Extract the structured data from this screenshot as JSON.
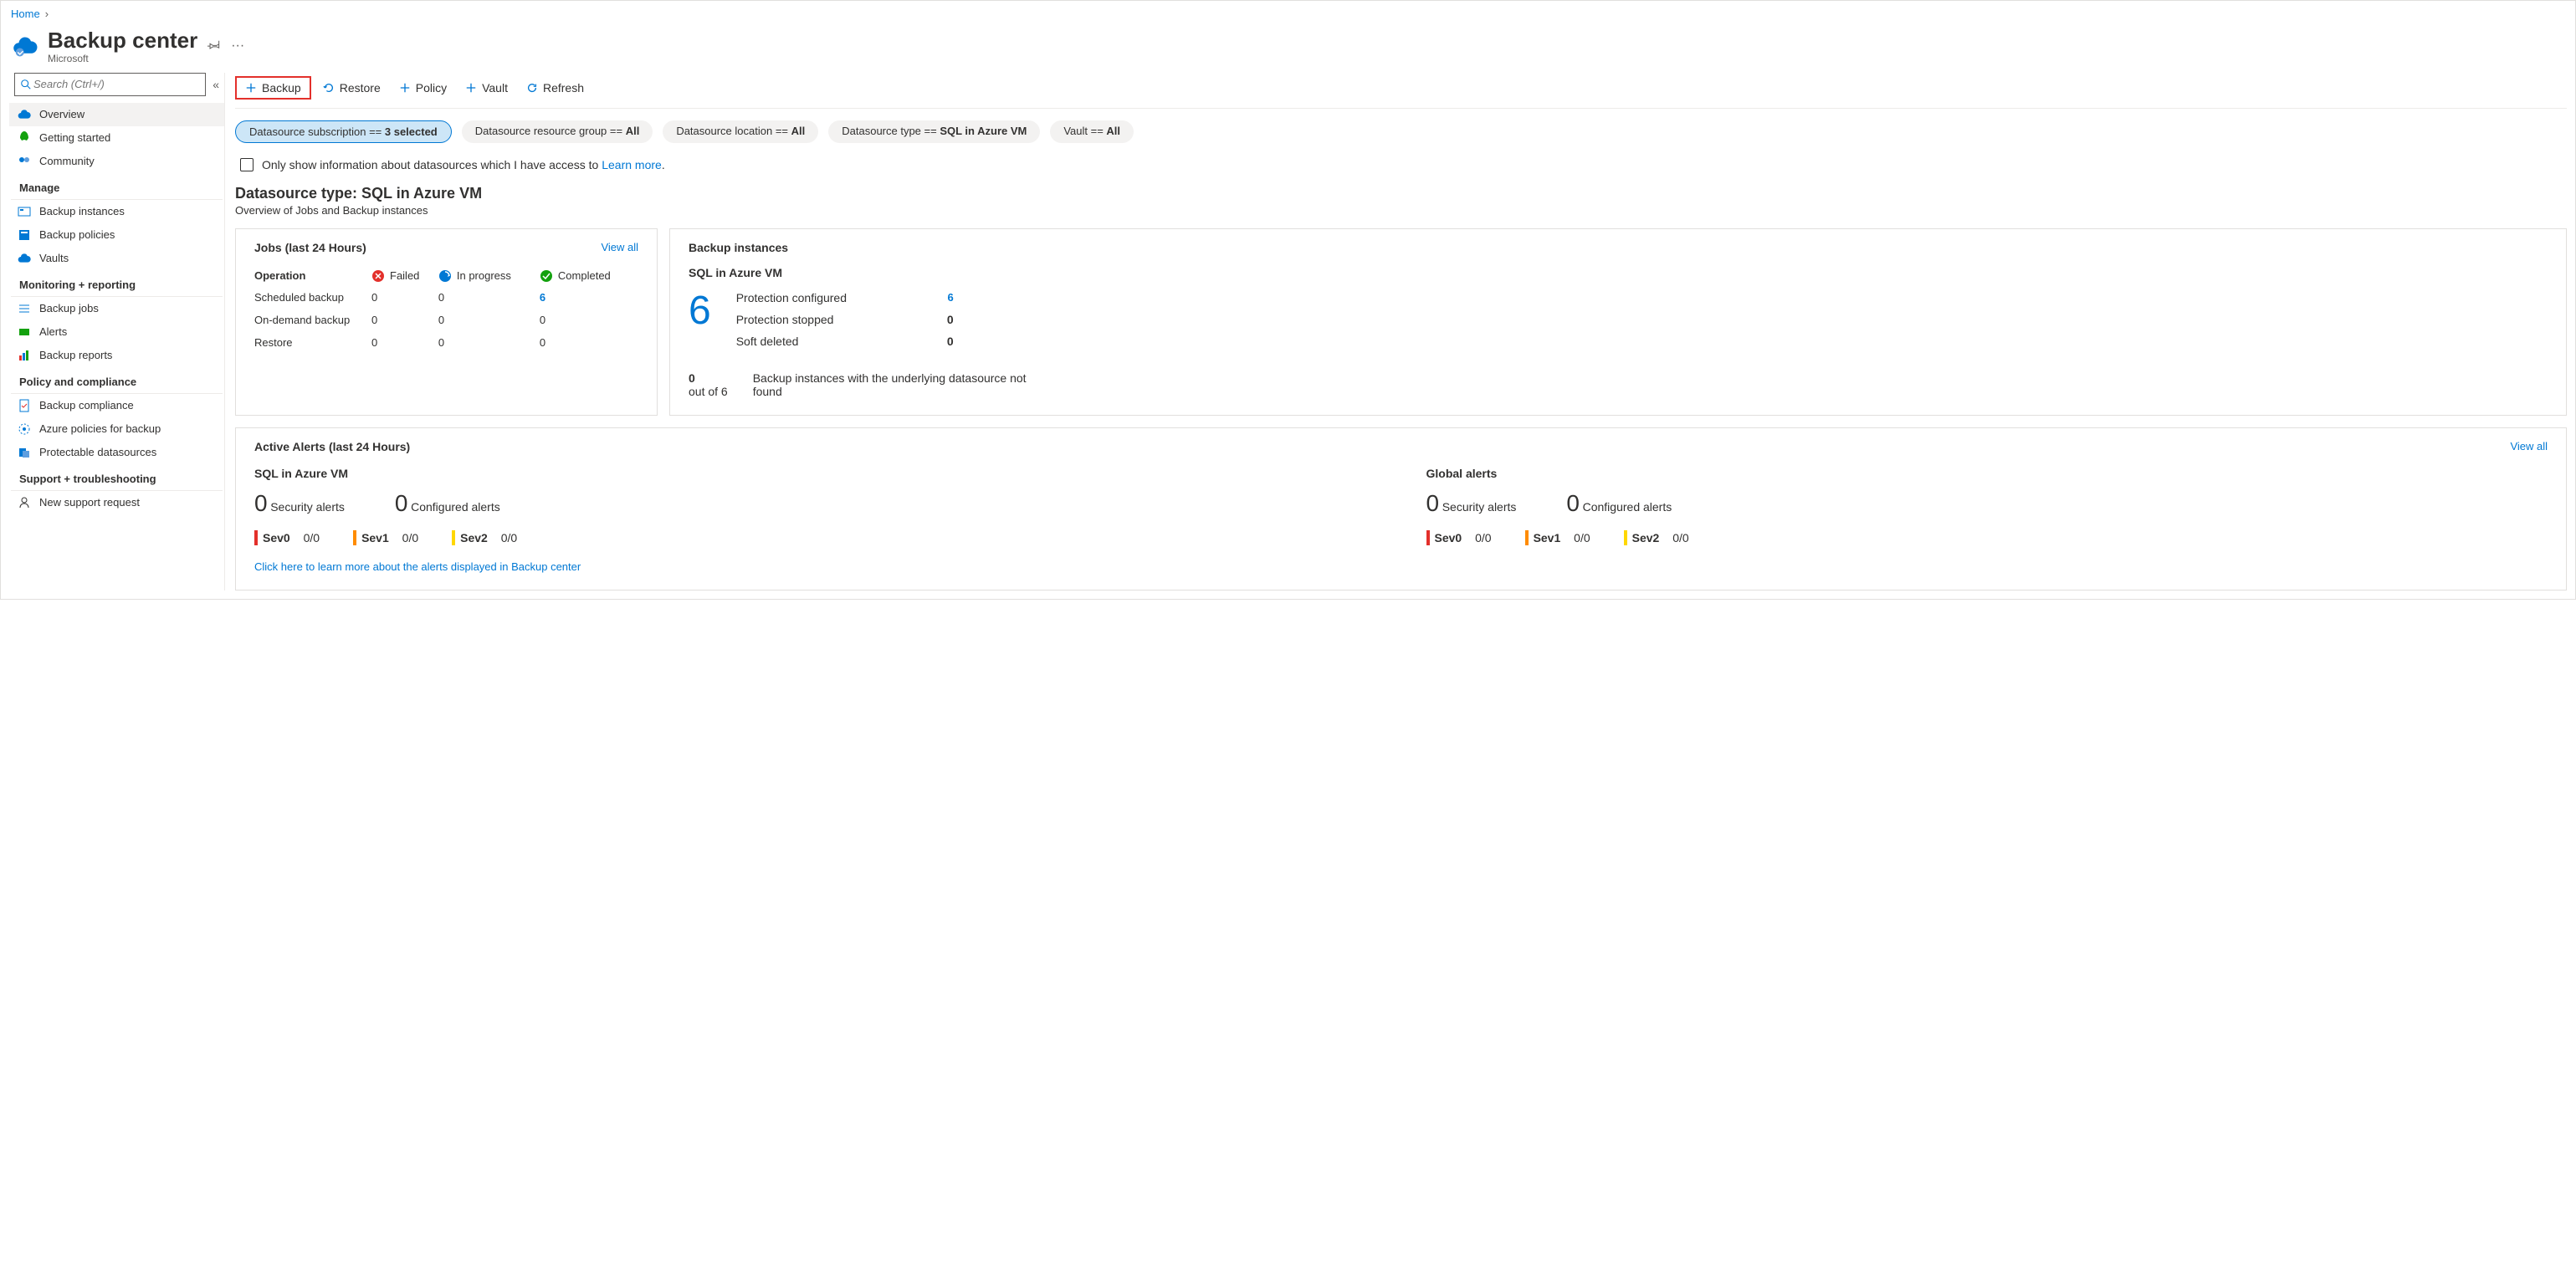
{
  "breadcrumb": {
    "home": "Home"
  },
  "header": {
    "title": "Backup center",
    "subtitle": "Microsoft"
  },
  "search": {
    "placeholder": "Search (Ctrl+/)"
  },
  "nav": {
    "overview": "Overview",
    "getting_started": "Getting started",
    "community": "Community",
    "section_manage": "Manage",
    "backup_instances": "Backup instances",
    "backup_policies": "Backup policies",
    "vaults": "Vaults",
    "section_monitoring": "Monitoring + reporting",
    "backup_jobs": "Backup jobs",
    "alerts": "Alerts",
    "backup_reports": "Backup reports",
    "section_policy": "Policy and compliance",
    "backup_compliance": "Backup compliance",
    "azure_policies": "Azure policies for backup",
    "protectable_ds": "Protectable datasources",
    "section_support": "Support + troubleshooting",
    "new_support": "New support request"
  },
  "toolbar": {
    "backup": "Backup",
    "restore": "Restore",
    "policy": "Policy",
    "vault": "Vault",
    "refresh": "Refresh"
  },
  "pills": {
    "sub_label": "Datasource subscription == ",
    "sub_value": "3 selected",
    "rg_label": "Datasource resource group == ",
    "rg_value": "All",
    "loc_label": "Datasource location == ",
    "loc_value": "All",
    "type_label": "Datasource type == ",
    "type_value": "SQL in Azure VM",
    "vault_label": "Vault == ",
    "vault_value": "All"
  },
  "check": {
    "text": "Only show information about datasources which I have access to ",
    "link": "Learn more"
  },
  "ds": {
    "title": "Datasource type: SQL in Azure VM",
    "sub": "Overview of Jobs and Backup instances"
  },
  "jobs": {
    "title": "Jobs (last 24 Hours)",
    "view_all": "View all",
    "operation": "Operation",
    "failed": "Failed",
    "in_progress": "In progress",
    "completed": "Completed",
    "rows": {
      "scheduled": {
        "label": "Scheduled backup",
        "failed": "0",
        "in_progress": "0",
        "completed": "6"
      },
      "ondemand": {
        "label": "On-demand backup",
        "failed": "0",
        "in_progress": "0",
        "completed": "0"
      },
      "restore": {
        "label": "Restore",
        "failed": "0",
        "in_progress": "0",
        "completed": "0"
      }
    }
  },
  "bi": {
    "title": "Backup instances",
    "subtitle": "SQL in Azure VM",
    "big": "6",
    "prot_conf_lbl": "Protection configured",
    "prot_conf_val": "6",
    "prot_stop_lbl": "Protection stopped",
    "prot_stop_val": "0",
    "soft_del_lbl": "Soft deleted",
    "soft_del_val": "0",
    "note_num": "0",
    "note_out": "out of 6",
    "note_text": "Backup instances with the underlying datasource not found"
  },
  "alerts": {
    "title": "Active Alerts (last 24 Hours)",
    "view_all": "View all",
    "col1_title": "SQL in Azure VM",
    "col2_title": "Global alerts",
    "security_lbl": "Security alerts",
    "configured_lbl": "Configured alerts",
    "zero": "0",
    "sev0": "Sev0",
    "sev1": "Sev1",
    "sev2": "Sev2",
    "sev_val": "0/0",
    "link": "Click here to learn more about the alerts displayed in Backup center"
  }
}
